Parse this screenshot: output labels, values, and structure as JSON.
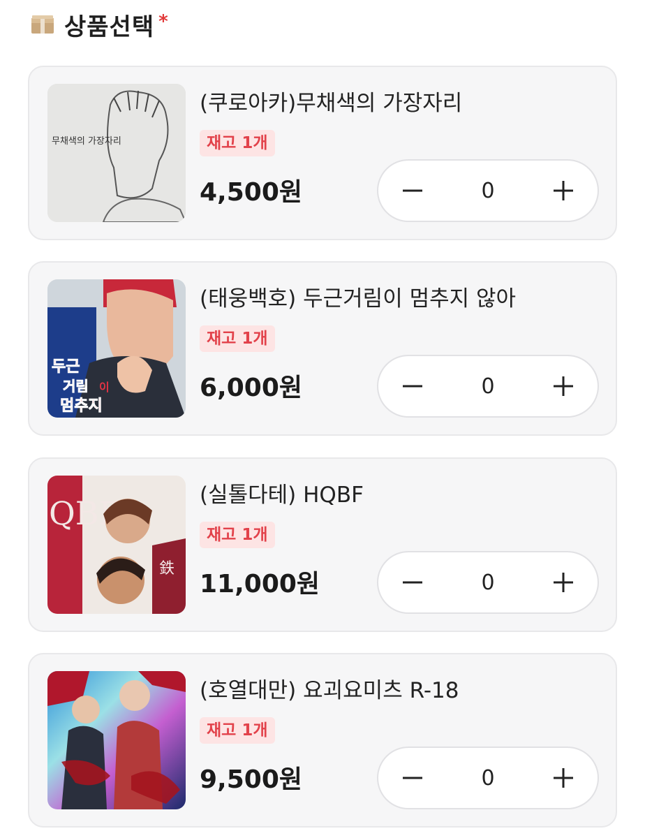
{
  "section": {
    "title": "상품선택",
    "required_mark": "*"
  },
  "products": [
    {
      "title": "(쿠로아카)무채색의 가장자리",
      "stock": "재고 1개",
      "price": "4,500원",
      "quantity": "0",
      "minus": "−",
      "plus": "+",
      "cover_text": "무채색의 가장자리"
    },
    {
      "title": "(태웅백호) 두근거림이 멈추지 않아",
      "stock": "재고 1개",
      "price": "6,000원",
      "quantity": "0",
      "minus": "−",
      "plus": "+",
      "cover_text": "두근 거림 이 멈추지"
    },
    {
      "title": "(실톨다테) HQBF",
      "stock": "재고 1개",
      "price": "11,000원",
      "quantity": "0",
      "minus": "−",
      "plus": "+",
      "cover_text": "QBF"
    },
    {
      "title": "(호열대만) 요괴요미츠 R-18",
      "stock": "재고 1개",
      "price": "9,500원",
      "quantity": "0",
      "minus": "−",
      "plus": "+",
      "cover_text": ""
    }
  ],
  "colors": {
    "accent_red": "#e23b3b",
    "stock_bg": "#fde4e4",
    "stock_text": "#e2414a",
    "card_bg": "#f6f6f7"
  },
  "icons": {
    "header": "box-icon",
    "minus": "minus-icon",
    "plus": "plus-icon"
  }
}
